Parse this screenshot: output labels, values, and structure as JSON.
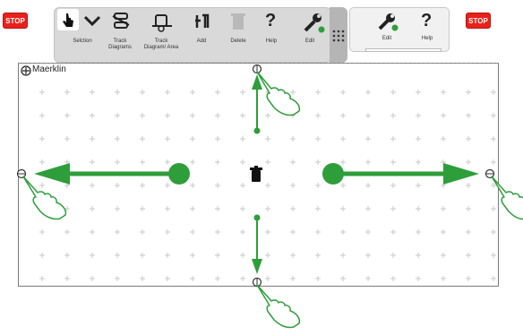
{
  "toolbar": {
    "stop_left": "STOP",
    "stop_right": "STOP",
    "tools": [
      {
        "label": "Selction",
        "icon": "pointer-hand-icon"
      },
      {
        "label": "Track Diagrams",
        "icon": "track-diagrams-icon"
      },
      {
        "label": "Track Diagram/ Area",
        "icon": "track-area-icon"
      },
      {
        "label": "Add",
        "icon": "add-icon"
      },
      {
        "label": "Delete",
        "icon": "delete-icon"
      },
      {
        "label": "Help",
        "icon": "help-icon"
      },
      {
        "label": "Edit",
        "icon": "edit-wrench-icon"
      }
    ],
    "right_panel": {
      "edit_label": "Edit",
      "help_label": "Help"
    }
  },
  "canvas": {
    "title": "Maerklin"
  },
  "colors": {
    "accent_green": "#2e9e3a",
    "stop_red": "#e8211b",
    "toolbar_bg": "#d9d9d9"
  }
}
